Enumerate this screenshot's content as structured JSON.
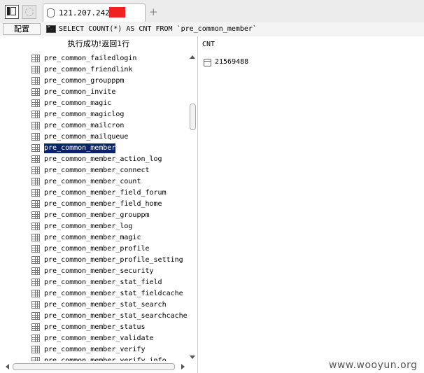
{
  "tab": {
    "title": "121.207.242.",
    "redaction_color": "#ee2222"
  },
  "toolbar": {
    "panel_icon": "sidebar-panel-icon",
    "gear_icon": "gear-icon",
    "new_tab_label": "+"
  },
  "query": {
    "config_label": "配置",
    "terminal_icon": "terminal-icon",
    "sql": "SELECT COUNT(*) AS CNT FROM `pre_common_member`"
  },
  "left_panel": {
    "status": "执行成功!返回1行",
    "selected_table": "pre_common_member",
    "tables": [
      "pre_common_failedlogin",
      "pre_common_friendlink",
      "pre_common_groupppm",
      "pre_common_invite",
      "pre_common_magic",
      "pre_common_magiclog",
      "pre_common_mailcron",
      "pre_common_mailqueue",
      "pre_common_member",
      "pre_common_member_action_log",
      "pre_common_member_connect",
      "pre_common_member_count",
      "pre_common_member_field_forum",
      "pre_common_member_field_home",
      "pre_common_member_grouppm",
      "pre_common_member_log",
      "pre_common_member_magic",
      "pre_common_member_profile",
      "pre_common_member_profile_setting",
      "pre_common_member_security",
      "pre_common_member_stat_field",
      "pre_common_member_stat_fieldcache",
      "pre_common_member_stat_search",
      "pre_common_member_stat_searchcache",
      "pre_common_member_status",
      "pre_common_member_validate",
      "pre_common_member_verify",
      "pre_common_member_verify_info"
    ]
  },
  "result": {
    "column": "CNT",
    "value": "21569488"
  },
  "watermark": "www.wooyun.org"
}
